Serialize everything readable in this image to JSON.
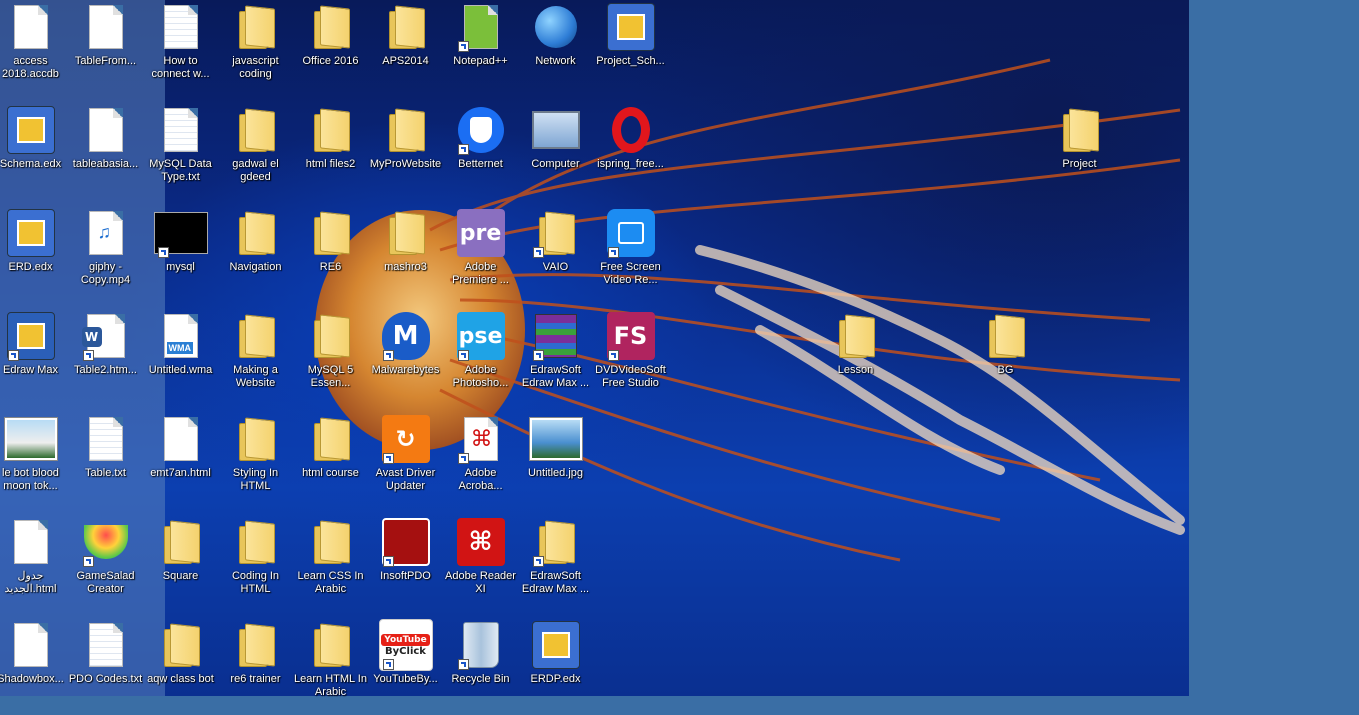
{
  "desktop": {
    "icons": [
      {
        "label": "access 2018.accdb",
        "kind": "doc",
        "color": "#c22"
      },
      {
        "label": "TableFrom...",
        "kind": "doc"
      },
      {
        "label": "How to connect w...",
        "kind": "txt"
      },
      {
        "label": "javascript coding",
        "kind": "folder"
      },
      {
        "label": "Office 2016",
        "kind": "folder"
      },
      {
        "label": "APS2014",
        "kind": "folder"
      },
      {
        "label": "Notepad++",
        "kind": "app",
        "color": "#7bbf3a"
      },
      {
        "label": "Network",
        "kind": "app",
        "color": "#2e7dd6"
      },
      {
        "label": "Project_Sch...",
        "kind": "app",
        "color": "#3b6fd1"
      },
      {
        "label": "Schema.edx",
        "kind": "app",
        "color": "#3b6fd1"
      },
      {
        "label": "tableabasia...",
        "kind": "doc"
      },
      {
        "label": "MySQL Data Type.txt",
        "kind": "txt"
      },
      {
        "label": "gadwal el gdeed",
        "kind": "folder"
      },
      {
        "label": "html files2",
        "kind": "folder"
      },
      {
        "label": "MyProWebsite",
        "kind": "folder"
      },
      {
        "label": "Betternet",
        "kind": "app",
        "color": "#1b6ef3"
      },
      {
        "label": "Computer",
        "kind": "app",
        "color": "#9aa6b8"
      },
      {
        "label": "ispring_free...",
        "kind": "app",
        "color": "#e1161c"
      },
      {
        "label": "Project",
        "kind": "folder"
      },
      {
        "label": "ERD.edx",
        "kind": "app",
        "color": "#3b6fd1"
      },
      {
        "label": "giphy - Copy.mp4",
        "kind": "app",
        "color": "#e8eef6"
      },
      {
        "label": "mysql",
        "kind": "app",
        "color": "#000000"
      },
      {
        "label": "Navigation",
        "kind": "folder"
      },
      {
        "label": "RE6",
        "kind": "folder"
      },
      {
        "label": "mashro3",
        "kind": "folder"
      },
      {
        "label": "Adobe Premiere ...",
        "kind": "app",
        "color": "#8a6fc0"
      },
      {
        "label": "VAIO",
        "kind": "folder"
      },
      {
        "label": "Free Screen Video Re...",
        "kind": "app",
        "color": "#1c8cf2"
      },
      {
        "label": "Edraw Max",
        "kind": "app",
        "color": "#2b5fb8"
      },
      {
        "label": "Table2.htm...",
        "kind": "app",
        "color": "#2b579a"
      },
      {
        "label": "Untitled.wma",
        "kind": "app",
        "color": "#2a7fd4"
      },
      {
        "label": "Making a Website",
        "kind": "folder"
      },
      {
        "label": "MySQL 5 Essen...",
        "kind": "folder"
      },
      {
        "label": "Malwarebytes",
        "kind": "app",
        "color": "#1a5cc8"
      },
      {
        "label": "Adobe Photosho...",
        "kind": "app",
        "color": "#1fa3e6"
      },
      {
        "label": "EdrawSoft Edraw Max ...",
        "kind": "app",
        "color": "#8b3a3a"
      },
      {
        "label": "DVDVideoSoft Free Studio",
        "kind": "app",
        "color": "#b0245f"
      },
      {
        "label": "Lesson",
        "kind": "folder"
      },
      {
        "label": "BG",
        "kind": "folder"
      },
      {
        "label": "le bot blood moon tok...",
        "kind": "app",
        "color": "#eee"
      },
      {
        "label": "Table.txt",
        "kind": "txt"
      },
      {
        "label": "emt7an.html",
        "kind": "doc"
      },
      {
        "label": "Styling In HTML",
        "kind": "folder"
      },
      {
        "label": "html course",
        "kind": "folder"
      },
      {
        "label": "Avast Driver Updater",
        "kind": "app",
        "color": "#f47a12"
      },
      {
        "label": "Adobe Acroba...",
        "kind": "app",
        "color": "#ffffff"
      },
      {
        "label": "Untitled.jpg",
        "kind": "app",
        "color": "#4a8fd0"
      },
      {
        "label": "جدول الجديد.html",
        "kind": "doc"
      },
      {
        "label": "GameSalad Creator",
        "kind": "app",
        "color": "#e6b422"
      },
      {
        "label": "Square",
        "kind": "folder"
      },
      {
        "label": "Coding In HTML",
        "kind": "folder"
      },
      {
        "label": "Learn CSS In Arabic",
        "kind": "folder"
      },
      {
        "label": "InsoftPDO",
        "kind": "app",
        "color": "#a51010"
      },
      {
        "label": "Adobe Reader XI",
        "kind": "app",
        "color": "#d11414"
      },
      {
        "label": "EdrawSoft Edraw Max ...",
        "kind": "folder"
      },
      {
        "label": "Shadowbox...",
        "kind": "doc"
      },
      {
        "label": "PDO Codes.txt",
        "kind": "txt"
      },
      {
        "label": "aqw class bot",
        "kind": "folder"
      },
      {
        "label": "re6 trainer",
        "kind": "folder"
      },
      {
        "label": "Learn HTML In Arabic",
        "kind": "folder"
      },
      {
        "label": "YouTubeBy...",
        "kind": "app",
        "color": "#e62117"
      },
      {
        "label": "Recycle Bin",
        "kind": "app",
        "color": "#a9c3dc"
      },
      {
        "label": "ERDP.edx",
        "kind": "app",
        "color": "#3b6fd1"
      }
    ]
  },
  "icon_text": {
    "pre": "pre",
    "pse": "pse",
    "fs": "FS",
    "w": "W",
    "wma": "WMA",
    "yt": "YouTube",
    "ytby": "ByClick"
  }
}
